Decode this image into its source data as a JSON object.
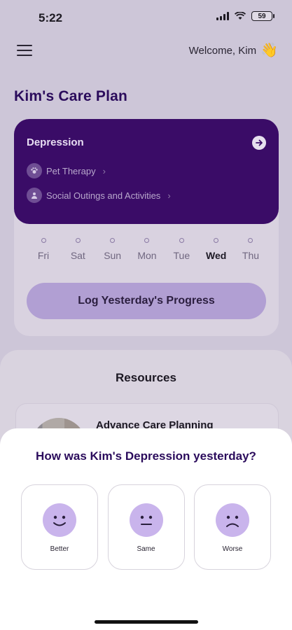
{
  "status_bar": {
    "time": "5:22",
    "battery": "59"
  },
  "header": {
    "welcome": "Welcome, Kim",
    "wave_emoji": "👋"
  },
  "care_plan": {
    "title": "Kim's Care Plan",
    "condition": "Depression",
    "activities": [
      {
        "label": "Pet Therapy",
        "icon": "paw-icon"
      },
      {
        "label": "Social Outings and Activities",
        "icon": "people-icon"
      }
    ],
    "days": [
      {
        "label": "Fri",
        "active": false
      },
      {
        "label": "Sat",
        "active": false
      },
      {
        "label": "Sun",
        "active": false
      },
      {
        "label": "Mon",
        "active": false
      },
      {
        "label": "Tue",
        "active": false
      },
      {
        "label": "Wed",
        "active": true
      },
      {
        "label": "Thu",
        "active": false
      }
    ],
    "log_button": "Log Yesterday's Progress"
  },
  "resources": {
    "title": "Resources",
    "items": [
      {
        "name": "Advance Care Planning"
      }
    ]
  },
  "sheet": {
    "question": "How was Kim's Depression yesterday?",
    "options": [
      {
        "label": "Better",
        "face": "smile-face-icon"
      },
      {
        "label": "Same",
        "face": "neutral-face-icon"
      },
      {
        "label": "Worse",
        "face": "frown-face-icon"
      }
    ]
  },
  "colors": {
    "brand_dark": "#3a0c67",
    "accent": "#b19fd3",
    "face": "#c9b4ec",
    "title": "#2b0c5c"
  }
}
